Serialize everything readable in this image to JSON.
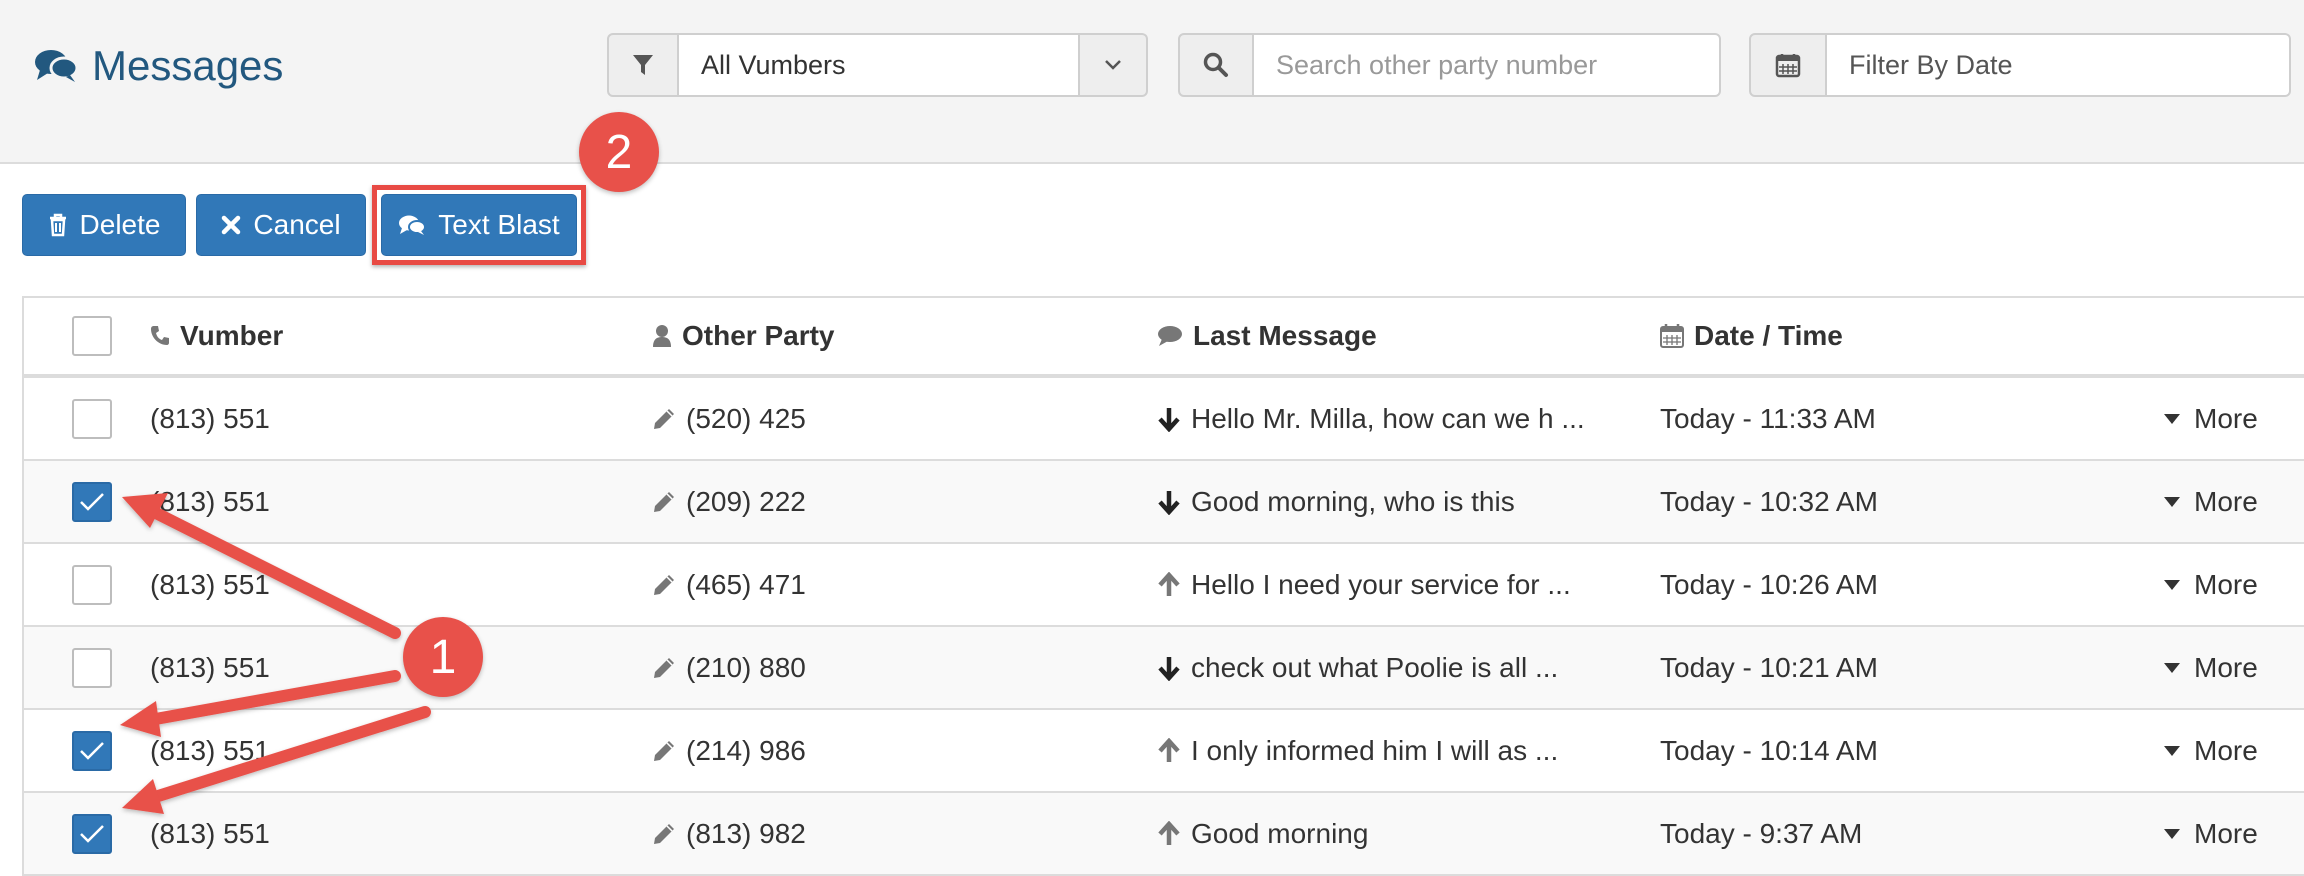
{
  "header": {
    "title": "Messages",
    "vumber_select": {
      "value": "All Vumbers"
    },
    "search": {
      "placeholder": "Search other party number"
    },
    "date_filter": {
      "placeholder": "Filter By Date"
    }
  },
  "toolbar": {
    "delete_label": "Delete",
    "cancel_label": "Cancel",
    "text_blast_label": "Text Blast"
  },
  "annotations": {
    "step1": "1",
    "step2": "2"
  },
  "table": {
    "columns": {
      "vumber": "Vumber",
      "other_party": "Other Party",
      "last_message": "Last Message",
      "date_time": "Date / Time"
    },
    "rows": [
      {
        "vumber": "(813) 551",
        "other_party": "(520) 425",
        "direction": "in",
        "last_message": "Hello Mr. Milla, how can we h ...",
        "date_time": "Today - 11:33 AM",
        "more": "More",
        "checked": false
      },
      {
        "vumber": "(813) 551",
        "other_party": "(209) 222",
        "direction": "in",
        "last_message": "Good morning, who is this",
        "date_time": "Today - 10:32 AM",
        "more": "More",
        "checked": true
      },
      {
        "vumber": "(813) 551",
        "other_party": "(465) 471",
        "direction": "out",
        "last_message": "Hello I need your service for ...",
        "date_time": "Today - 10:26 AM",
        "more": "More",
        "checked": false
      },
      {
        "vumber": "(813) 551",
        "other_party": "(210) 880",
        "direction": "in",
        "last_message": "check out what Poolie is all ...",
        "date_time": "Today - 10:21 AM",
        "more": "More",
        "checked": false
      },
      {
        "vumber": "(813) 551",
        "other_party": "(214) 986",
        "direction": "out",
        "last_message": "I only informed him I will as ...",
        "date_time": "Today - 10:14 AM",
        "more": "More",
        "checked": true
      },
      {
        "vumber": "(813) 551",
        "other_party": "(813) 982",
        "direction": "out",
        "last_message": "Good morning",
        "date_time": "Today - 9:37 AM",
        "more": "More",
        "checked": true
      }
    ]
  },
  "colors": {
    "primary": "#3178b8",
    "title": "#22587f",
    "annotation": "#e8514a"
  }
}
